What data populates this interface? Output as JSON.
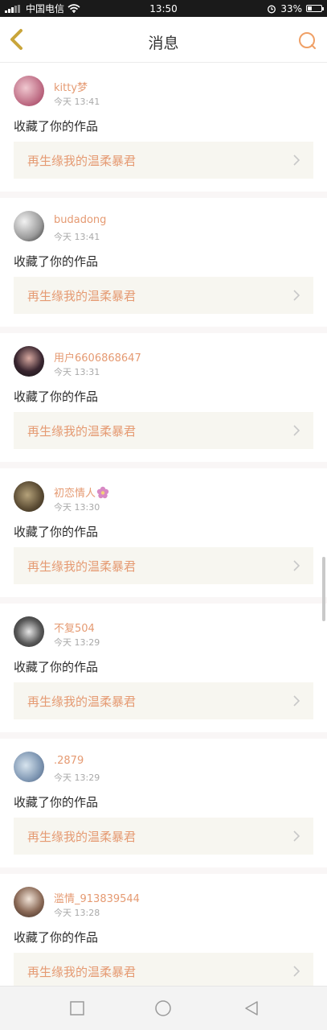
{
  "status_bar": {
    "signal_text": "中国电信",
    "time": "13:50",
    "battery_percent": "33%",
    "battery_level": 0.33,
    "icons": [
      "signal-icon",
      "wifi-icon",
      "alarm-icon",
      "battery-icon"
    ]
  },
  "header": {
    "title": "消息",
    "back_icon": "back-chevron-icon",
    "search_icon": "search-icon"
  },
  "colors": {
    "accent": "#e59a72",
    "back_icon": "#c9a53a",
    "search_icon": "#f0a066",
    "card_bg": "#f7f6f0",
    "separator": "#f9f6f6"
  },
  "notifications": [
    {
      "username": "kitty梦",
      "time": "今天 13:41",
      "action": "收藏了你的作品",
      "work_title": "再生缘我的温柔暴君"
    },
    {
      "username": "budadong",
      "time": "今天 13:41",
      "action": "收藏了你的作品",
      "work_title": "再生缘我的温柔暴君"
    },
    {
      "username": "用户6606868647",
      "time": "今天 13:31",
      "action": "收藏了你的作品",
      "work_title": "再生缘我的温柔暴君"
    },
    {
      "username": "初恋情人",
      "username_emoji": "flower-icon",
      "time": "今天 13:30",
      "action": "收藏了你的作品",
      "work_title": "再生缘我的温柔暴君"
    },
    {
      "username": "不复504",
      "time": "今天 13:29",
      "action": "收藏了你的作品",
      "work_title": "再生缘我的温柔暴君"
    },
    {
      "username": ".2879",
      "time": "今天 13:29",
      "action": "收藏了你的作品",
      "work_title": "再生缘我的温柔暴君"
    },
    {
      "username": "滥情_913839544",
      "time": "今天 13:28",
      "action": "收藏了你的作品",
      "work_title": "再生缘我的温柔暴君"
    }
  ],
  "system_nav": [
    "recents-square-icon",
    "home-circle-icon",
    "back-triangle-icon"
  ]
}
